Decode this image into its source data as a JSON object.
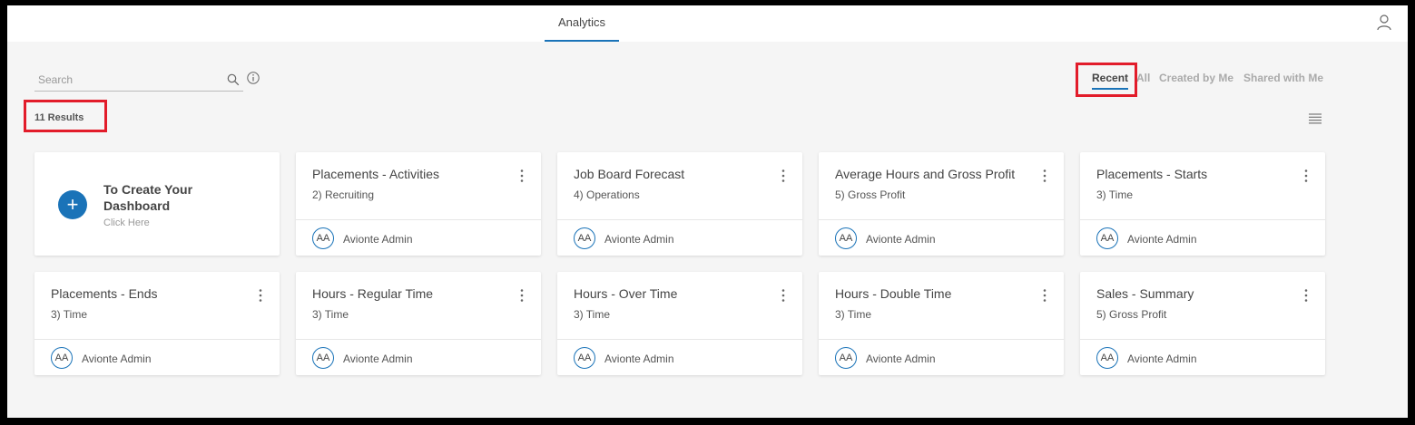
{
  "header": {
    "tab": "Analytics",
    "user_icon": "user-icon"
  },
  "search": {
    "placeholder": "Search",
    "value": ""
  },
  "results_label": "11 Results",
  "filters": [
    {
      "label": "Recent",
      "active": true
    },
    {
      "label": "All",
      "active": false
    },
    {
      "label": "Created by Me",
      "active": false
    },
    {
      "label": "Shared with Me",
      "active": false
    }
  ],
  "create_card": {
    "title": "To Create Your Dashboard",
    "subtitle": "Click Here"
  },
  "cards": [
    {
      "title": "Placements - Activities",
      "category": "2) Recruiting",
      "initials": "AA",
      "owner": "Avionte Admin"
    },
    {
      "title": "Job Board Forecast",
      "category": "4) Operations",
      "initials": "AA",
      "owner": "Avionte Admin"
    },
    {
      "title": "Average Hours and Gross Profit",
      "category": "5) Gross Profit",
      "initials": "AA",
      "owner": "Avionte Admin"
    },
    {
      "title": "Placements - Starts",
      "category": "3) Time",
      "initials": "AA",
      "owner": "Avionte Admin"
    },
    {
      "title": "Placements - Ends",
      "category": "3) Time",
      "initials": "AA",
      "owner": "Avionte Admin"
    },
    {
      "title": "Hours - Regular Time",
      "category": "3) Time",
      "initials": "AA",
      "owner": "Avionte Admin"
    },
    {
      "title": "Hours - Over Time",
      "category": "3) Time",
      "initials": "AA",
      "owner": "Avionte Admin"
    },
    {
      "title": "Hours - Double Time",
      "category": "3) Time",
      "initials": "AA",
      "owner": "Avionte Admin"
    },
    {
      "title": "Sales - Summary",
      "category": "5) Gross Profit",
      "initials": "AA",
      "owner": "Avionte Admin"
    }
  ],
  "colors": {
    "accent": "#1a73b8",
    "highlight": "#e21c2a"
  }
}
